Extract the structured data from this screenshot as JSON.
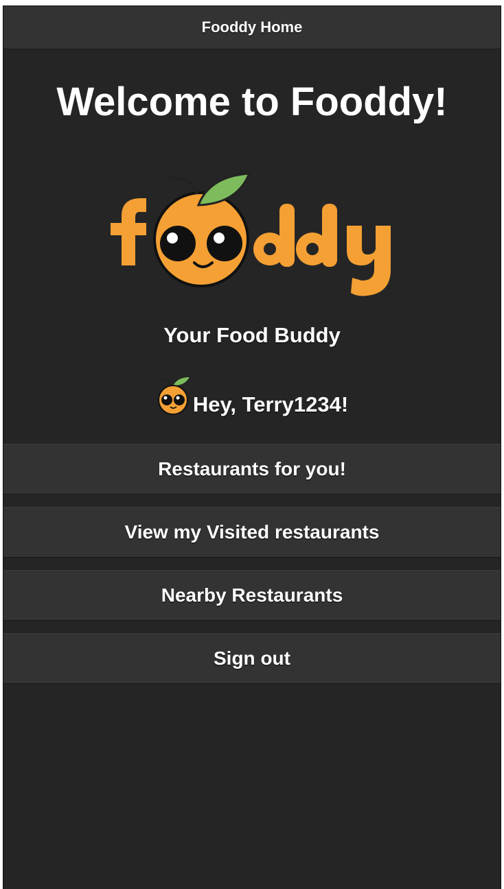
{
  "header": {
    "title": "Fooddy Home"
  },
  "main": {
    "welcome": "Welcome to Fooddy!",
    "logo_text": "foddy",
    "tagline": "Your Food Buddy",
    "greeting": "Hey, Terry1234!"
  },
  "menu": {
    "restaurants_for_you": "Restaurants for you!",
    "visited": "View my Visited restaurants",
    "nearby": "Nearby Restaurants",
    "sign_out": "Sign out"
  },
  "colors": {
    "background": "#252525",
    "bar": "#333333",
    "brand_orange": "#f4a034",
    "leaf_green": "#7dbb5c"
  }
}
